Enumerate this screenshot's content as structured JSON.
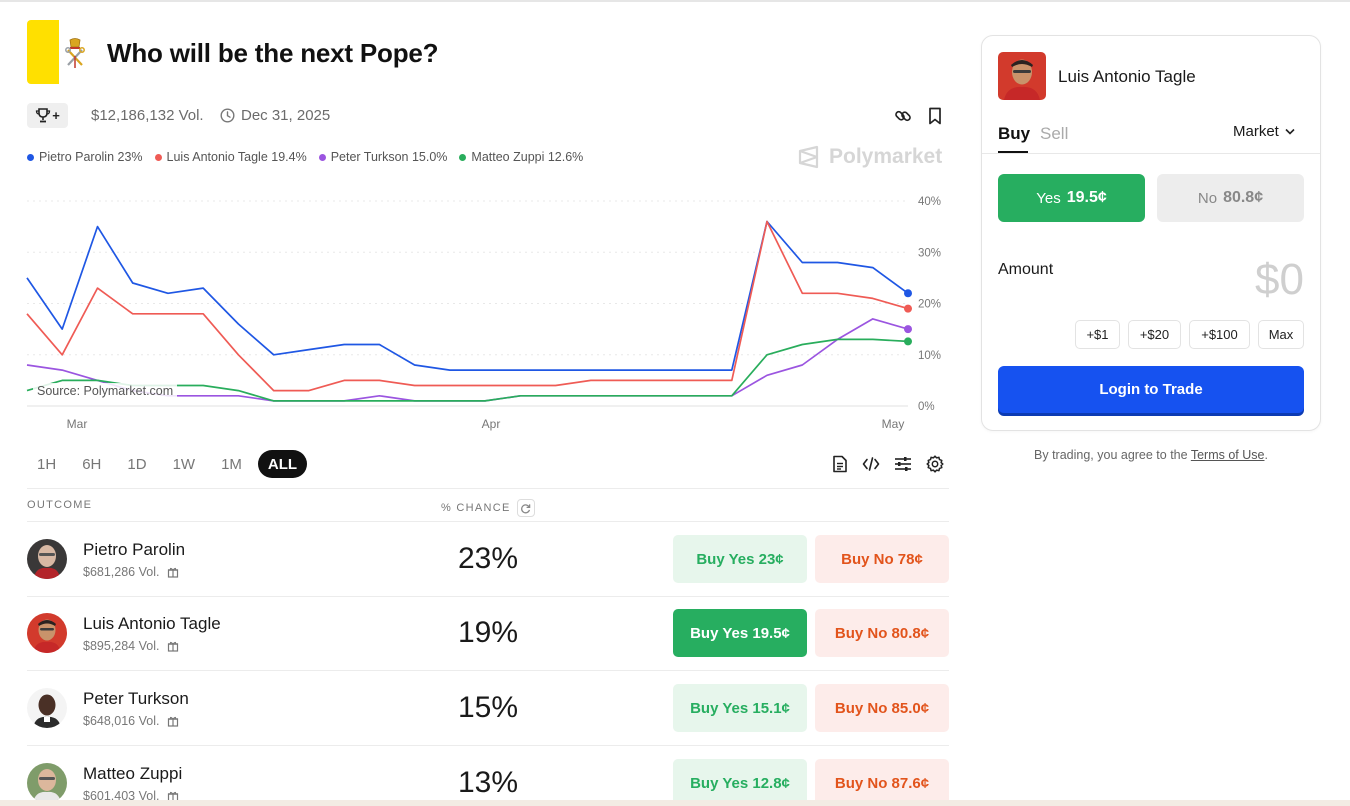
{
  "market": {
    "title": "Who will be the next Pope?",
    "volume": "$12,186,132 Vol.",
    "end_date": "Dec 31, 2025",
    "flag_colors": {
      "left": "#ffe000",
      "right": "#ffffff"
    }
  },
  "legend": [
    {
      "label": "Pietro Parolin 23%",
      "color": "#1f57e4"
    },
    {
      "label": "Luis Antonio Tagle 19.4%",
      "color": "#ef5b55"
    },
    {
      "label": "Peter Turkson 15.0%",
      "color": "#9b55e0"
    },
    {
      "label": "Matteo Zuppi 12.6%",
      "color": "#29ad5c"
    }
  ],
  "watermark": "Polymarket",
  "source": "Source: Polymarket.com",
  "chart_data": {
    "type": "line",
    "x": [
      "Feb 24",
      "Feb 27",
      "Mar 1",
      "Mar 4",
      "Mar 7",
      "Mar 10",
      "Mar 12",
      "Mar 15",
      "Mar 18",
      "Mar 21",
      "Mar 24",
      "Mar 27",
      "Mar 30",
      "Apr 2",
      "Apr 5",
      "Apr 8",
      "Apr 11",
      "Apr 14",
      "Apr 17",
      "Apr 20",
      "Apr 22",
      "Apr 24",
      "Apr 26",
      "Apr 28",
      "Apr 30",
      "May 1"
    ],
    "series": [
      {
        "name": "Pietro Parolin",
        "color": "#1f57e4",
        "values": [
          25,
          15,
          35,
          24,
          22,
          23,
          16,
          10,
          11,
          12,
          12,
          8,
          7,
          7,
          7,
          7,
          7,
          7,
          7,
          7,
          7,
          36,
          28,
          28,
          27,
          22
        ]
      },
      {
        "name": "Luis Antonio Tagle",
        "color": "#ef5b55",
        "values": [
          18,
          10,
          23,
          18,
          18,
          18,
          10,
          3,
          3,
          5,
          5,
          4,
          4,
          4,
          4,
          4,
          5,
          5,
          5,
          5,
          5,
          36,
          22,
          22,
          21,
          19
        ]
      },
      {
        "name": "Peter Turkson",
        "color": "#9b55e0",
        "values": [
          8,
          7,
          5,
          3,
          2,
          2,
          2,
          1,
          1,
          1,
          2,
          1,
          1,
          1,
          2,
          2,
          2,
          2,
          2,
          2,
          2,
          6,
          8,
          13,
          17,
          15
        ]
      },
      {
        "name": "Matteo Zuppi",
        "color": "#29ad5c",
        "values": [
          3,
          5,
          5,
          4,
          4,
          4,
          3,
          1,
          1,
          1,
          1,
          1,
          1,
          1,
          2,
          2,
          2,
          2,
          2,
          2,
          2,
          10,
          12,
          13,
          13,
          12.6
        ]
      }
    ],
    "x_ticks": [
      "Mar",
      "Apr",
      "May"
    ],
    "y_ticks": [
      "40%",
      "30%",
      "20%",
      "10%",
      "0%"
    ],
    "ylim": [
      0,
      40
    ],
    "grid": true
  },
  "ranges": [
    "1H",
    "6H",
    "1D",
    "1W",
    "1M",
    "ALL"
  ],
  "active_range": "ALL",
  "table": {
    "col_outcome": "OUTCOME",
    "col_chance": "% CHANCE",
    "rows": [
      {
        "name": "Pietro Parolin",
        "volume": "$681,286 Vol.",
        "chance": "23%",
        "buy_yes": "Buy Yes 23¢",
        "buy_no": "Buy No 78¢"
      },
      {
        "name": "Luis Antonio Tagle",
        "volume": "$895,284 Vol.",
        "chance": "19%",
        "buy_yes": "Buy Yes 19.5¢",
        "buy_no": "Buy No 80.8¢"
      },
      {
        "name": "Peter Turkson",
        "volume": "$648,016 Vol.",
        "chance": "15%",
        "buy_yes": "Buy Yes 15.1¢",
        "buy_no": "Buy No 85.0¢"
      },
      {
        "name": "Matteo Zuppi",
        "volume": "$601,403 Vol.",
        "chance": "13%",
        "buy_yes": "Buy Yes 12.8¢",
        "buy_no": "Buy No 87.6¢"
      }
    ]
  },
  "panel": {
    "selected_outcome": "Luis Antonio Tagle",
    "tab_buy": "Buy",
    "tab_sell": "Sell",
    "order_type": "Market",
    "yes_label": "Yes",
    "yes_price": "19.5¢",
    "no_label": "No",
    "no_price": "80.8¢",
    "amount_label": "Amount",
    "amount_value": "$0",
    "chips": [
      "+$1",
      "+$20",
      "+$100",
      "Max"
    ],
    "login": "Login to Trade"
  },
  "terms": {
    "prefix": "By trading, you agree to the ",
    "link": "Terms of Use",
    "suffix": "."
  }
}
